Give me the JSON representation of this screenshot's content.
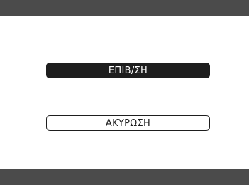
{
  "dialog": {
    "confirm_label": "ΕΠΙΒ/ΣΗ",
    "cancel_label": "ΑΚΥΡΩΣΗ"
  },
  "colors": {
    "bar": "#4b4b4b",
    "background": "#ffffff",
    "confirm_fill": "#1e1e1e",
    "confirm_text": "#ffffff",
    "cancel_border": "#1e1e1e",
    "cancel_text": "#1e1e1e"
  }
}
